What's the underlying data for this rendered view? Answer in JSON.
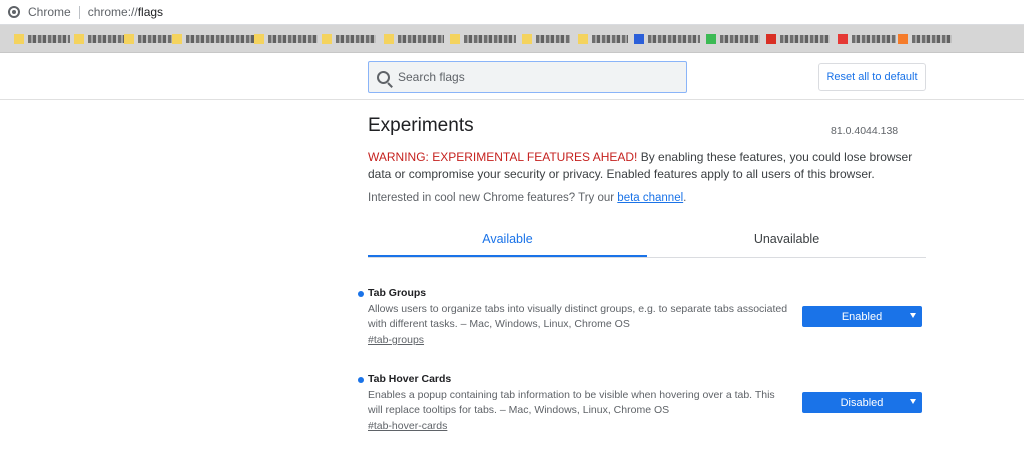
{
  "omnibox": {
    "site_label": "Chrome",
    "url_scheme": "chrome://",
    "url_path": "flags"
  },
  "search": {
    "placeholder": "Search flags"
  },
  "reset_button": {
    "label": "Reset all to default"
  },
  "page": {
    "title": "Experiments",
    "version": "81.0.4044.138",
    "warning_strong": "WARNING: EXPERIMENTAL FEATURES AHEAD!",
    "warning_rest": " By enabling these features, you could lose browser data or compromise your security or privacy. Enabled features apply to all users of this browser.",
    "interest_text": "Interested in cool new Chrome features? Try our ",
    "interest_link": "beta channel",
    "interest_end": "."
  },
  "tabs": [
    {
      "label": "Available",
      "active": true
    },
    {
      "label": "Unavailable",
      "active": false
    }
  ],
  "flags": [
    {
      "name": "Tab Groups",
      "description": "Allows users to organize tabs into visually distinct groups, e.g. to separate tabs associated with different tasks. – Mac, Windows, Linux, Chrome OS",
      "link": "#tab-groups",
      "state": "Enabled"
    },
    {
      "name": "Tab Hover Cards",
      "description": "Enables a popup containing tab information to be visible when hovering over a tab. This will replace tooltips for tabs. – Mac, Windows, Linux, Chrome OS",
      "link": "#tab-hover-cards",
      "state": "Disabled"
    }
  ],
  "colors": {
    "accent": "#1a73e8",
    "warning": "#c5221f"
  }
}
